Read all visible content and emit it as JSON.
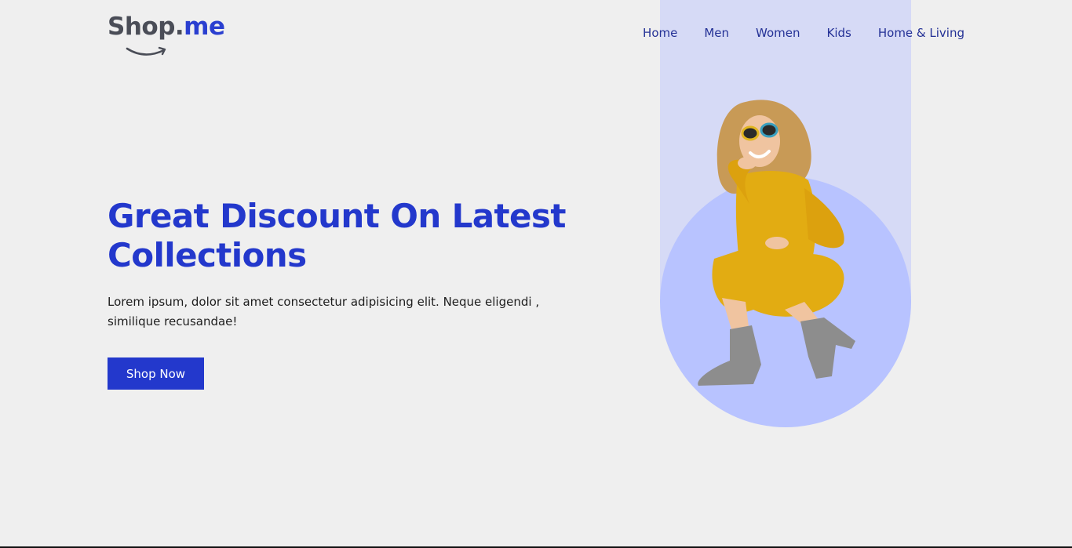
{
  "brand": {
    "logo_part_1": "Shop.",
    "logo_part_2": "me"
  },
  "nav": {
    "items": [
      {
        "label": "Home"
      },
      {
        "label": "Men"
      },
      {
        "label": "Women"
      },
      {
        "label": "Kids"
      },
      {
        "label": "Home & Living"
      }
    ]
  },
  "hero": {
    "title": "Great Discount On Latest Collections",
    "description": "Lorem ipsum, dolor sit amet consectetur adipisicing elit. Neque eligendi , similique recusandae!",
    "cta_label": "Shop Now"
  },
  "colors": {
    "primary": "#2338cc",
    "nav_text": "#243196",
    "logo_gray": "#4a4d57",
    "band": "#d6daf6",
    "circle": "#b8c3ff",
    "background": "#efefef"
  }
}
